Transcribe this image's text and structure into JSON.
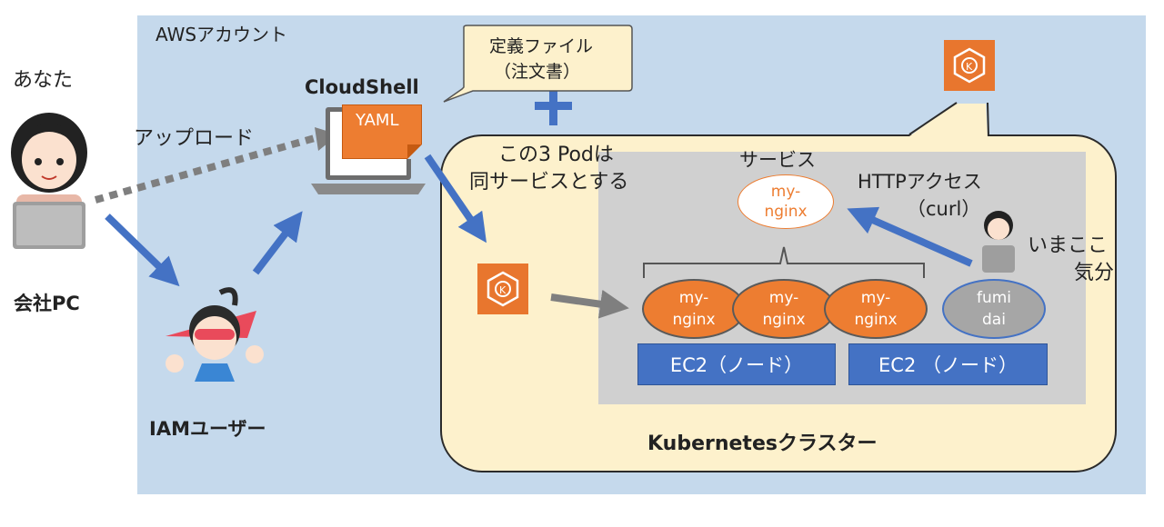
{
  "aws_account_label": "AWSアカウント",
  "you_label": "あなた",
  "company_pc_label": "会社PC",
  "upload_label": "アップロード",
  "cloudshell_label": "CloudShell",
  "yaml_label": "YAML",
  "definition_callout": {
    "line1": "定義ファイル",
    "line2": "（注文書）"
  },
  "iam_user_label": "IAMユーザー",
  "pods_note": {
    "line1": "この3 Podは",
    "line2": "同サービスとする"
  },
  "service_label": "サービス",
  "service_name": {
    "line1": "my-",
    "line2": "nginx"
  },
  "http_access": {
    "line1": "HTTPアクセス",
    "line2": "（curl）"
  },
  "mood": {
    "line1": "いまここ",
    "line2": "気分"
  },
  "pods": [
    {
      "line1": "my-",
      "line2": "nginx"
    },
    {
      "line1": "my-",
      "line2": "nginx"
    },
    {
      "line1": "my-",
      "line2": "nginx"
    }
  ],
  "fumidai": {
    "line1": "fumi",
    "line2": "dai"
  },
  "ec2_nodes": [
    "EC2（ノード）",
    "EC2 （ノード）"
  ],
  "cluster_label": "Kubernetesクラスター",
  "colors": {
    "aws_bg": "#c5d9ec",
    "cluster_bg": "#fdf1cc",
    "service_bg": "#d0d0d0",
    "ec2_blue": "#4472c4",
    "pod_orange": "#ed7d31",
    "arrow_blue": "#4472c4"
  }
}
